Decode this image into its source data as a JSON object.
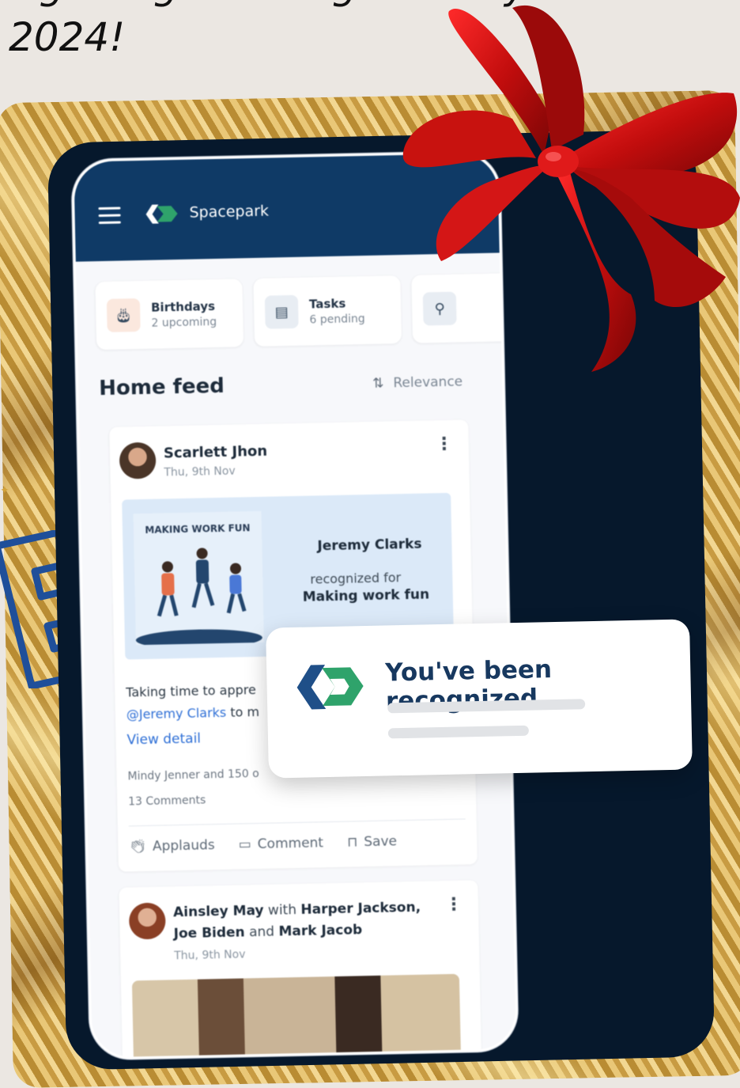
{
  "headline": {
    "line1": "ing things coming our way in",
    "line2": "2024!"
  },
  "app": {
    "brand_name": "Spacepark"
  },
  "widgets": [
    {
      "title": "Birthdays",
      "subtitle": "2 upcoming",
      "icon": "cake-icon"
    },
    {
      "title": "Tasks",
      "subtitle": "6 pending",
      "icon": "clipboard-icon"
    }
  ],
  "feed": {
    "title": "Home feed",
    "sort_label": "Relevance"
  },
  "post1": {
    "author": "Scarlett Jhon",
    "date": "Thu, 9th Nov",
    "art_title": "MAKING WORK FUN",
    "recognized_name": "Jeremy Clarks",
    "recognized_for": "recognized for",
    "recognized_reason": "Making work fun",
    "text_line1": "Taking time to appre",
    "mention": "@Jeremy Clarks",
    "text_after_mention": " to m",
    "view_detail": "View detail",
    "reactions": "Mindy Jenner and 150 o",
    "comments_count": "13 Comments",
    "actions": {
      "applauds": "Applauds",
      "comment": "Comment",
      "save": "Save"
    }
  },
  "post2": {
    "author": "Ainsley May",
    "with_word": "with",
    "tag1": "Harper Jackson,",
    "tag2": "Joe Biden",
    "and_word": "and",
    "tag3": "Mark Jacob",
    "date": "Thu, 9th Nov"
  },
  "notification": {
    "title": "You've been recognized"
  },
  "colors": {
    "app_header": "#0f3a66",
    "tablet": "#06182c",
    "accent_link": "#2e6fd6",
    "logo_blue": "#1f4f88",
    "logo_green": "#2fa36b",
    "bow_red": "#d01616"
  }
}
